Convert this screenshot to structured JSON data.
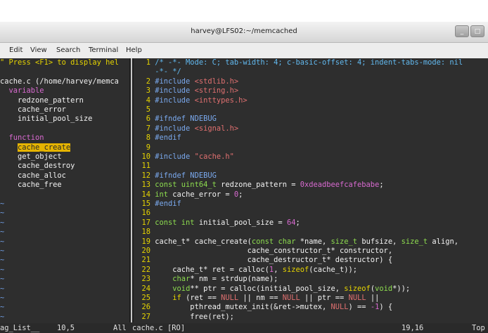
{
  "window": {
    "title": "harvey@LFS02:~/memcached",
    "buttons": [
      "_",
      "□"
    ]
  },
  "menu": [
    "Edit",
    "View",
    "Search",
    "Terminal",
    "Help"
  ],
  "taglist": {
    "hint": "\" Press <F1> to display hel",
    "file": "cache.c (/home/harvey/memca",
    "sections": [
      {
        "title": "variable",
        "items": [
          "redzone_pattern",
          "cache_error",
          "initial_pool_size"
        ]
      },
      {
        "title": "function",
        "items": [
          "cache_create",
          "get_object",
          "cache_destroy",
          "cache_alloc",
          "cache_free"
        ]
      }
    ],
    "selected": "cache_create",
    "tilde_rows": 13
  },
  "editor": {
    "lines": [
      {
        "n": "1",
        "segs": [
          [
            "cm",
            "/* -*- Mode: C; tab-width: 4; c-basic-offset: 4; indent-tabs-mode: nil"
          ]
        ]
      },
      {
        "n": "",
        "segs": [
          [
            "cm",
            "-*- */"
          ]
        ]
      },
      {
        "n": "2",
        "segs": [
          [
            "pp",
            "#include "
          ],
          [
            "st",
            "<stdlib.h>"
          ]
        ]
      },
      {
        "n": "3",
        "segs": [
          [
            "pp",
            "#include "
          ],
          [
            "st",
            "<string.h>"
          ]
        ]
      },
      {
        "n": "4",
        "segs": [
          [
            "pp",
            "#include "
          ],
          [
            "st",
            "<inttypes.h>"
          ]
        ]
      },
      {
        "n": "5",
        "segs": []
      },
      {
        "n": "6",
        "segs": [
          [
            "pp",
            "#ifndef NDEBUG"
          ]
        ]
      },
      {
        "n": "7",
        "segs": [
          [
            "pp",
            "#include "
          ],
          [
            "st",
            "<signal.h>"
          ]
        ]
      },
      {
        "n": "8",
        "segs": [
          [
            "pp",
            "#endif"
          ]
        ]
      },
      {
        "n": "9",
        "segs": []
      },
      {
        "n": "10",
        "segs": [
          [
            "pp",
            "#include "
          ],
          [
            "st",
            "\"cache.h\""
          ]
        ]
      },
      {
        "n": "11",
        "segs": []
      },
      {
        "n": "12",
        "segs": [
          [
            "pp",
            "#ifndef NDEBUG"
          ]
        ]
      },
      {
        "n": "13",
        "segs": [
          [
            "ty",
            "const uint64_t"
          ],
          [
            "tx",
            " redzone_pattern = "
          ],
          [
            "nu",
            "0xdeadbeefcafebabe"
          ],
          [
            "tx",
            ";"
          ]
        ]
      },
      {
        "n": "14",
        "segs": [
          [
            "ty",
            "int"
          ],
          [
            "tx",
            " cache_error = "
          ],
          [
            "nu",
            "0"
          ],
          [
            "tx",
            ";"
          ]
        ]
      },
      {
        "n": "15",
        "segs": [
          [
            "pp",
            "#endif"
          ]
        ]
      },
      {
        "n": "16",
        "segs": []
      },
      {
        "n": "17",
        "segs": [
          [
            "ty",
            "const int"
          ],
          [
            "tx",
            " initial_pool_size = "
          ],
          [
            "nu",
            "64"
          ],
          [
            "tx",
            ";"
          ]
        ]
      },
      {
        "n": "18",
        "segs": []
      },
      {
        "n": "19",
        "segs": [
          [
            "tx",
            "cache_t* cache_create("
          ],
          [
            "ty",
            "const char"
          ],
          [
            "tx",
            " *name, "
          ],
          [
            "ty",
            "size_t"
          ],
          [
            "tx",
            " bufsize, "
          ],
          [
            "ty",
            "size_t"
          ],
          [
            "tx",
            " align,"
          ]
        ]
      },
      {
        "n": "20",
        "segs": [
          [
            "tx",
            "                     cache_constructor_t* constructor,"
          ]
        ]
      },
      {
        "n": "21",
        "segs": [
          [
            "tx",
            "                     cache_destructor_t* destructor) {"
          ]
        ]
      },
      {
        "n": "22",
        "segs": [
          [
            "tx",
            "    cache_t* ret = calloc("
          ],
          [
            "nu",
            "1"
          ],
          [
            "tx",
            ", "
          ],
          [
            "kw",
            "sizeof"
          ],
          [
            "tx",
            "(cache_t));"
          ]
        ]
      },
      {
        "n": "23",
        "segs": [
          [
            "tx",
            "    "
          ],
          [
            "ty",
            "char"
          ],
          [
            "tx",
            "* nm = strdup(name);"
          ]
        ]
      },
      {
        "n": "24",
        "segs": [
          [
            "tx",
            "    "
          ],
          [
            "ty",
            "void"
          ],
          [
            "tx",
            "** ptr = calloc(initial_pool_size, "
          ],
          [
            "kw",
            "sizeof"
          ],
          [
            "tx",
            "("
          ],
          [
            "ty",
            "void"
          ],
          [
            "tx",
            "*));"
          ]
        ]
      },
      {
        "n": "25",
        "segs": [
          [
            "tx",
            "    "
          ],
          [
            "kw",
            "if"
          ],
          [
            "tx",
            " (ret == "
          ],
          [
            "st",
            "NULL"
          ],
          [
            "tx",
            " || nm == "
          ],
          [
            "st",
            "NULL"
          ],
          [
            "tx",
            " || ptr == "
          ],
          [
            "st",
            "NULL"
          ],
          [
            "tx",
            " ||"
          ]
        ]
      },
      {
        "n": "26",
        "segs": [
          [
            "tx",
            "        pthread_mutex_init(&ret->mutex, "
          ],
          [
            "st",
            "NULL"
          ],
          [
            "tx",
            ") == "
          ],
          [
            "nu",
            "-1"
          ],
          [
            "tx",
            ") {"
          ]
        ]
      },
      {
        "n": "27",
        "segs": [
          [
            "tx",
            "        free(ret);"
          ]
        ]
      }
    ]
  },
  "statusbar": {
    "left_name": "ag_List__",
    "left_pos": "10,5",
    "left_all": "All",
    "file": "cache.c [RO]",
    "right_pos": "19,16",
    "right_top": "Top"
  },
  "colors": {
    "comment": "#62b9ef",
    "preproc": "#7aa9ee",
    "type": "#8ddc4f",
    "string": "#e07070",
    "keyword": "#e6d400",
    "number": "#d86ad0",
    "highlight": "#e6b400"
  }
}
